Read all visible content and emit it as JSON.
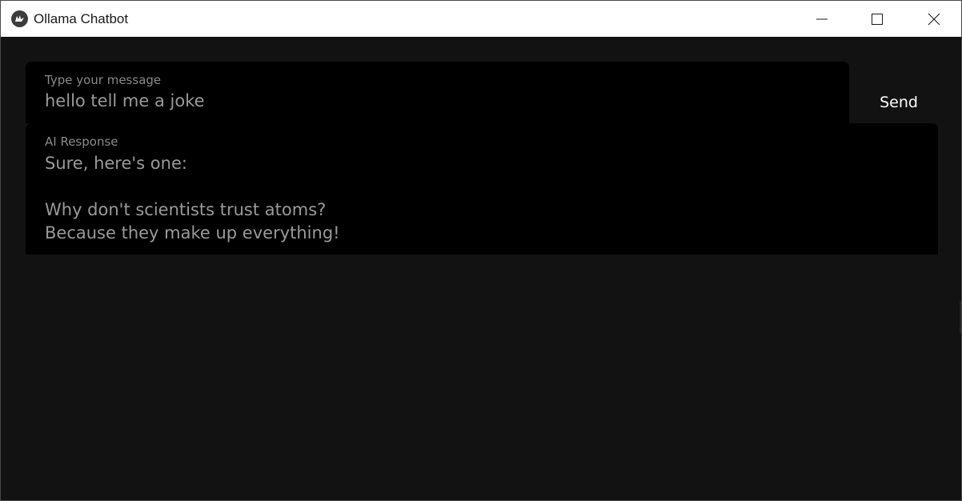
{
  "window": {
    "title": "Ollama Chatbot"
  },
  "icons": {
    "app": "kivy-app-icon",
    "minimize": "minimize-icon",
    "maximize": "maximize-icon",
    "close": "close-icon"
  },
  "input": {
    "hint": "Type your message",
    "value": "hello tell me a joke"
  },
  "send": {
    "label": "Send"
  },
  "response": {
    "hint": "AI Response",
    "text": "Sure, here's one:\n\nWhy don't scientists trust atoms?\nBecause they make up everything!"
  },
  "colors": {
    "background": "#121212",
    "field_background": "#000000",
    "hint_text": "#8a8a8a",
    "field_text": "#9a9a9a",
    "button_text": "#ffffff",
    "titlebar": "#ffffff"
  }
}
